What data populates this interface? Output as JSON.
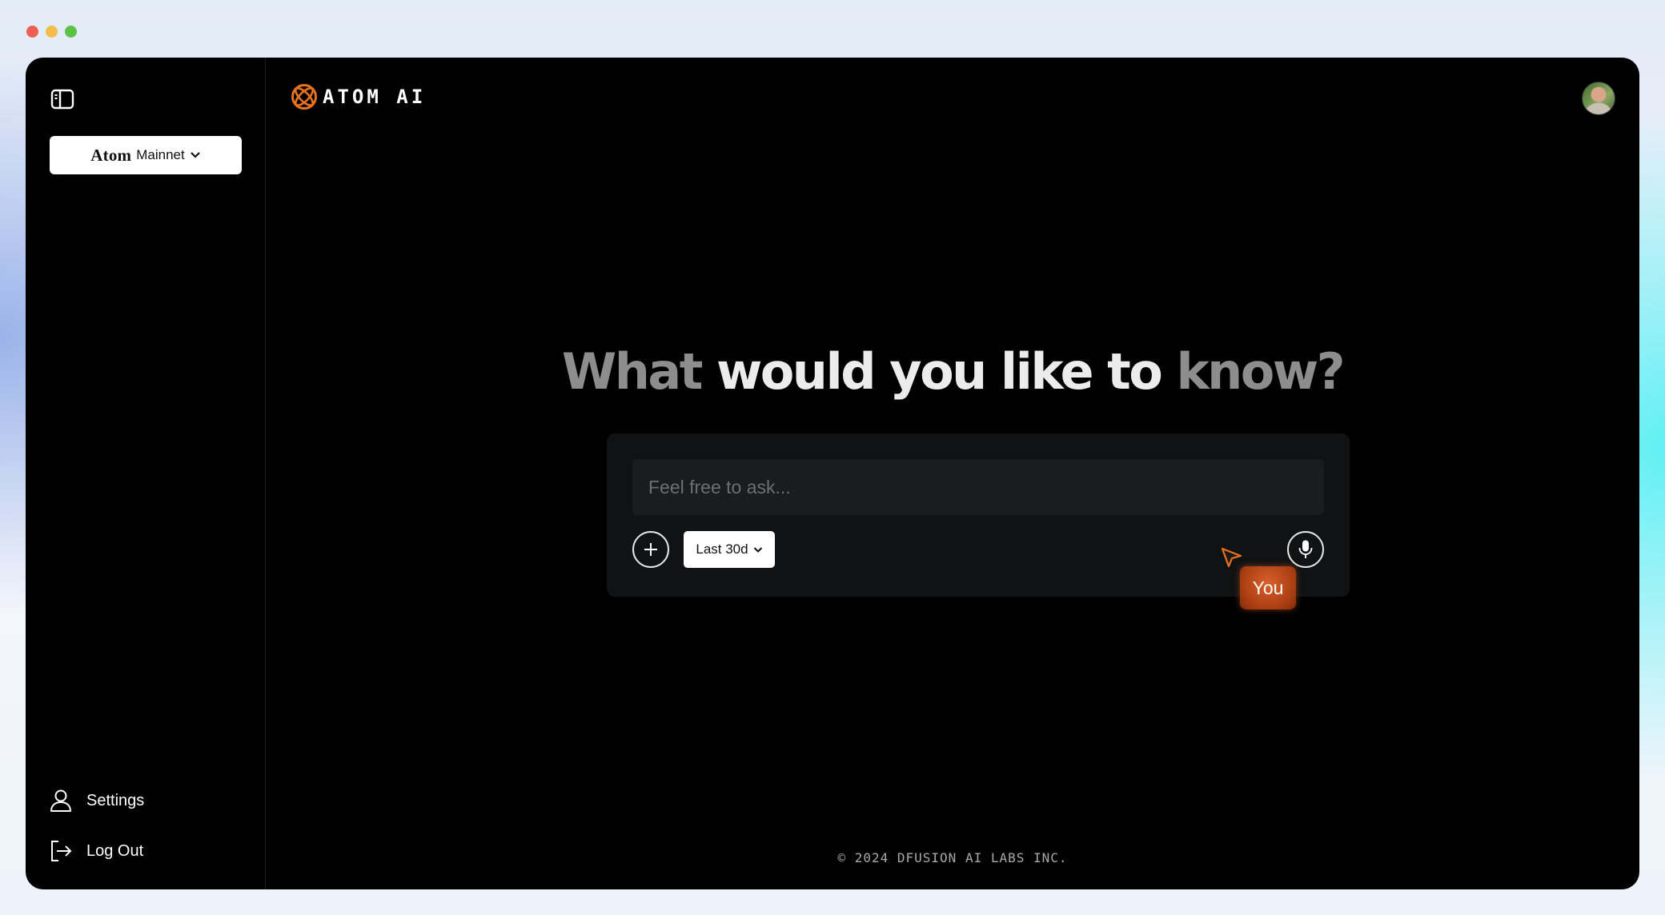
{
  "sidebar": {
    "network": {
      "brand": "Atom",
      "name": "Mainnet"
    },
    "items": [
      {
        "label": "Settings",
        "icon": "user-icon"
      },
      {
        "label": "Log Out",
        "icon": "logout-icon"
      }
    ]
  },
  "header": {
    "logo_text": "ATOM AI"
  },
  "main": {
    "headline": {
      "part1": "What",
      "part2": "would you like to",
      "part3": "know?"
    },
    "search": {
      "placeholder": "Feel free to ask...",
      "value": ""
    },
    "time_range": {
      "selected": "Last 30d"
    }
  },
  "cursor": {
    "label": "You"
  },
  "footer": {
    "text": "© 2024 DFUSION AI LABS INC."
  },
  "colors": {
    "accent": "#e8731f",
    "background": "#000000",
    "cursor_tag": "#c24f1c"
  }
}
